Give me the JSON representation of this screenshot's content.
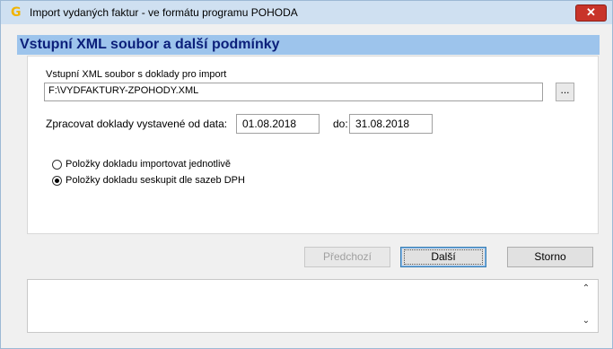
{
  "window": {
    "title": "Import vydaných faktur - ve formátu programu POHODA",
    "app_icon": "G",
    "close_glyph": "✕"
  },
  "header": {
    "title": "Vstupní XML soubor a další podmínky"
  },
  "form": {
    "file_label": "Vstupní XML soubor s doklady pro import",
    "file_value": "F:\\VYDFAKTURY-ZPOHODY.XML",
    "browse_label": "...",
    "date_label": "Zpracovat doklady vystavené od data:",
    "date_from": "01.08.2018",
    "date_to_label": "do:",
    "date_to": "31.08.2018",
    "radio_options": [
      {
        "label": "Položky dokladu  importovat jednotlivě",
        "selected": false
      },
      {
        "label": "Položky dokladu seskupit dle sazeb DPH",
        "selected": true
      }
    ]
  },
  "buttons": {
    "prev": {
      "label": "Předchozí",
      "enabled": false
    },
    "next": {
      "label": "Další",
      "enabled": true
    },
    "cancel": {
      "label": "Storno",
      "enabled": true
    }
  },
  "log": {
    "text": "",
    "scroll_up": "⌃",
    "scroll_down": "⌄"
  },
  "colors": {
    "titlebar": "#cfe0f1",
    "header_bg": "#9dc4ec",
    "header_text": "#0b1f7a",
    "close_button": "#c8342a"
  }
}
